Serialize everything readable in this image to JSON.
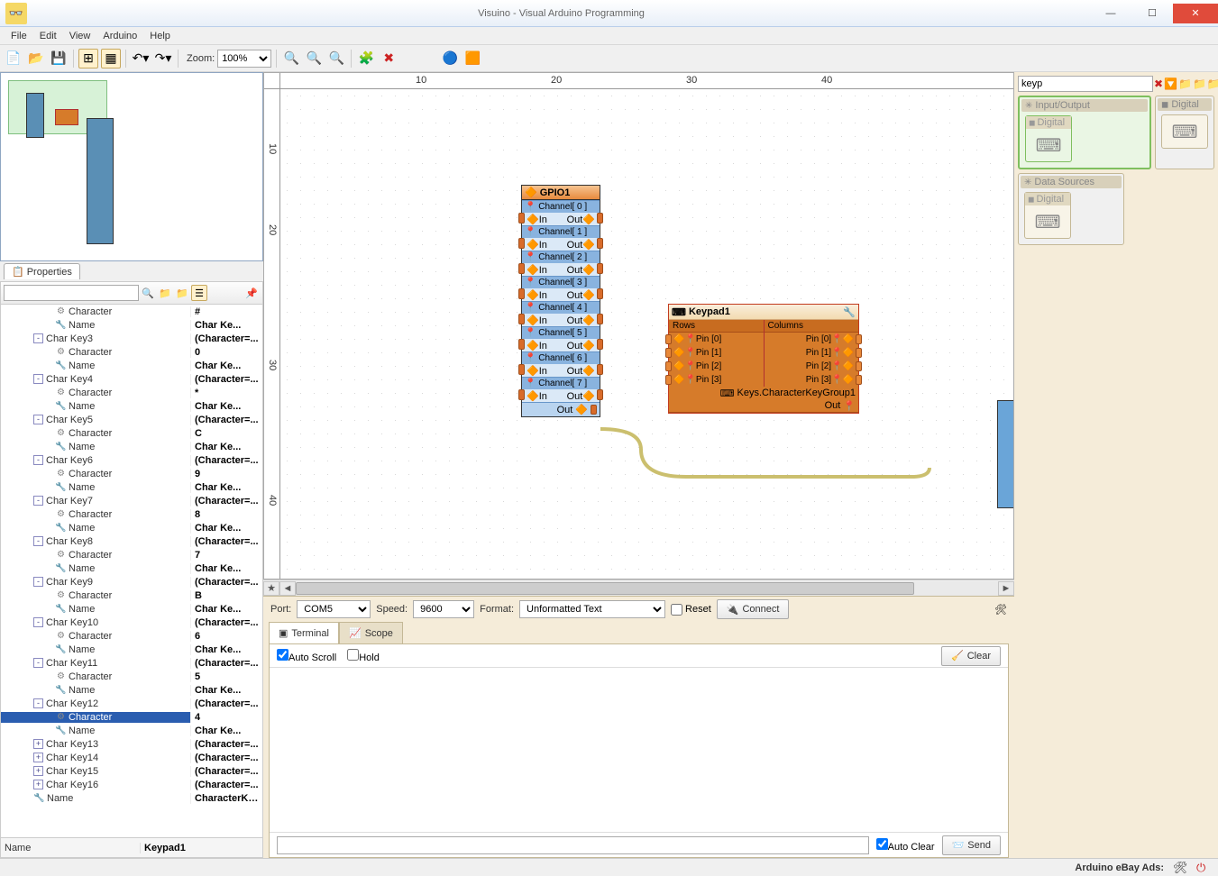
{
  "window": {
    "title": "Visuino - Visual Arduino Programming"
  },
  "menu": {
    "file": "File",
    "edit": "Edit",
    "view": "View",
    "arduino": "Arduino",
    "help": "Help"
  },
  "toolbar": {
    "zoom_label": "Zoom:",
    "zoom_value": "100%"
  },
  "ruler_h": {
    "t10": "10",
    "t20": "20",
    "t30": "30",
    "t40": "40"
  },
  "ruler_v": {
    "t10": "10",
    "t20": "20",
    "t30": "30",
    "t40": "40"
  },
  "properties": {
    "tab": "Properties",
    "rows": [
      {
        "d": 5,
        "icn": "⚙",
        "lbl": "Character",
        "val": "#"
      },
      {
        "d": 5,
        "icn": "🔧",
        "lbl": "Name",
        "val": "Char Ke..."
      },
      {
        "d": 3,
        "exp": "-",
        "lbl": "Char Key3",
        "val": "(Character=..."
      },
      {
        "d": 5,
        "icn": "⚙",
        "lbl": "Character",
        "val": "0"
      },
      {
        "d": 5,
        "icn": "🔧",
        "lbl": "Name",
        "val": "Char Ke..."
      },
      {
        "d": 3,
        "exp": "-",
        "lbl": "Char Key4",
        "val": "(Character=..."
      },
      {
        "d": 5,
        "icn": "⚙",
        "lbl": "Character",
        "val": "*"
      },
      {
        "d": 5,
        "icn": "🔧",
        "lbl": "Name",
        "val": "Char Ke..."
      },
      {
        "d": 3,
        "exp": "-",
        "lbl": "Char Key5",
        "val": "(Character=..."
      },
      {
        "d": 5,
        "icn": "⚙",
        "lbl": "Character",
        "val": "C"
      },
      {
        "d": 5,
        "icn": "🔧",
        "lbl": "Name",
        "val": "Char Ke..."
      },
      {
        "d": 3,
        "exp": "-",
        "lbl": "Char Key6",
        "val": "(Character=..."
      },
      {
        "d": 5,
        "icn": "⚙",
        "lbl": "Character",
        "val": "9"
      },
      {
        "d": 5,
        "icn": "🔧",
        "lbl": "Name",
        "val": "Char Ke..."
      },
      {
        "d": 3,
        "exp": "-",
        "lbl": "Char Key7",
        "val": "(Character=..."
      },
      {
        "d": 5,
        "icn": "⚙",
        "lbl": "Character",
        "val": "8"
      },
      {
        "d": 5,
        "icn": "🔧",
        "lbl": "Name",
        "val": "Char Ke..."
      },
      {
        "d": 3,
        "exp": "-",
        "lbl": "Char Key8",
        "val": "(Character=..."
      },
      {
        "d": 5,
        "icn": "⚙",
        "lbl": "Character",
        "val": "7"
      },
      {
        "d": 5,
        "icn": "🔧",
        "lbl": "Name",
        "val": "Char Ke..."
      },
      {
        "d": 3,
        "exp": "-",
        "lbl": "Char Key9",
        "val": "(Character=..."
      },
      {
        "d": 5,
        "icn": "⚙",
        "lbl": "Character",
        "val": "B"
      },
      {
        "d": 5,
        "icn": "🔧",
        "lbl": "Name",
        "val": "Char Ke..."
      },
      {
        "d": 3,
        "exp": "-",
        "lbl": "Char Key10",
        "val": "(Character=..."
      },
      {
        "d": 5,
        "icn": "⚙",
        "lbl": "Character",
        "val": "6"
      },
      {
        "d": 5,
        "icn": "🔧",
        "lbl": "Name",
        "val": "Char Ke..."
      },
      {
        "d": 3,
        "exp": "-",
        "lbl": "Char Key11",
        "val": "(Character=..."
      },
      {
        "d": 5,
        "icn": "⚙",
        "lbl": "Character",
        "val": "5"
      },
      {
        "d": 5,
        "icn": "🔧",
        "lbl": "Name",
        "val": "Char Ke..."
      },
      {
        "d": 3,
        "exp": "-",
        "lbl": "Char Key12",
        "val": "(Character=..."
      },
      {
        "d": 5,
        "sel": true,
        "icn": "⚙",
        "lbl": "Character",
        "val": "4"
      },
      {
        "d": 5,
        "icn": "🔧",
        "lbl": "Name",
        "val": "Char Ke..."
      },
      {
        "d": 3,
        "exp": "+",
        "lbl": "Char Key13",
        "val": "(Character=..."
      },
      {
        "d": 3,
        "exp": "+",
        "lbl": "Char Key14",
        "val": "(Character=..."
      },
      {
        "d": 3,
        "exp": "+",
        "lbl": "Char Key15",
        "val": "(Character=..."
      },
      {
        "d": 3,
        "exp": "+",
        "lbl": "Char Key16",
        "val": "(Character=..."
      },
      {
        "d": 3,
        "icn": "🔧",
        "lbl": "Name",
        "val": "CharacterKey..."
      }
    ],
    "footer_label": "Name",
    "footer_value": "Keypad1"
  },
  "gpio": {
    "title": "GPIO1",
    "channels": [
      "Channel[ 0 ]",
      "Channel[ 1 ]",
      "Channel[ 2 ]",
      "Channel[ 3 ]",
      "Channel[ 4 ]",
      "Channel[ 5 ]",
      "Channel[ 6 ]",
      "Channel[ 7 ]"
    ],
    "in": "In",
    "out": "Out",
    "out_main": "Out"
  },
  "keypad": {
    "title": "Keypad1",
    "rows_h": "Rows",
    "cols_h": "Columns",
    "row_pins": [
      "Pin [0]",
      "Pin [1]",
      "Pin [2]",
      "Pin [3]"
    ],
    "col_pins": [
      "Pin [0]",
      "Pin [1]",
      "Pin [2]",
      "Pin [3]"
    ],
    "keys_title": "Keys.CharacterKeyGroup1",
    "keys_out": "Out"
  },
  "bottom": {
    "port_l": "Port:",
    "port_v": "COM5",
    "speed_l": "Speed:",
    "speed_v": "9600",
    "format_l": "Format:",
    "format_v": "Unformatted Text",
    "reset": "Reset",
    "connect": "Connect",
    "tab_term": "Terminal",
    "tab_scope": "Scope",
    "autoscroll": "Auto Scroll",
    "hold": "Hold",
    "clear": "Clear",
    "autoclear": "Auto Clear",
    "send": "Send"
  },
  "right": {
    "search": "keyp",
    "cat_io": "Input/Output",
    "cat_digital": "Digital",
    "cat_ds": "Data Sources",
    "comp_digital": "Digital"
  },
  "status": {
    "ads": "Arduino eBay Ads:"
  }
}
